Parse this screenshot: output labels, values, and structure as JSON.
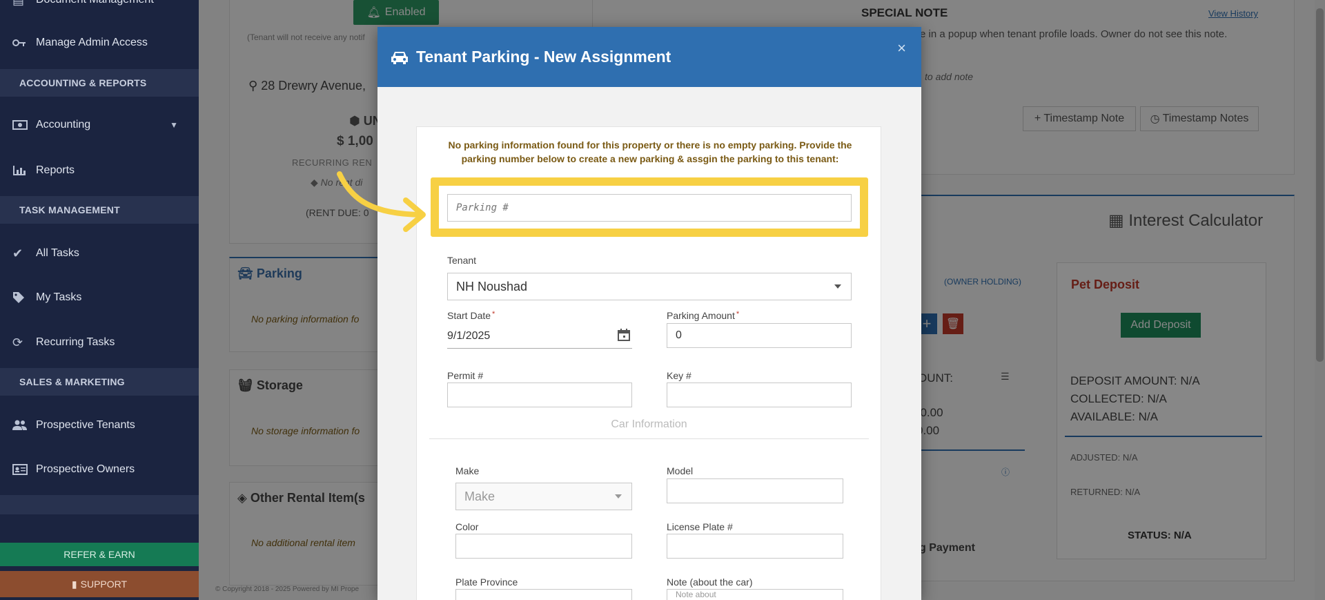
{
  "sidebar": {
    "items_top": [
      {
        "label": "Document Management",
        "icon": "document-icon"
      },
      {
        "label": "Manage Admin Access",
        "icon": "key-icon"
      }
    ],
    "section_accounting": "ACCOUNTING & REPORTS",
    "accounting": "Accounting",
    "reports": "Reports",
    "section_tasks": "TASK MANAGEMENT",
    "all_tasks": "All Tasks",
    "my_tasks": "My Tasks",
    "recurring_tasks": "Recurring Tasks",
    "section_sales": "SALES & MARKETING",
    "prospective_tenants": "Prospective Tenants",
    "prospective_owners": "Prospective Owners",
    "refer": "REFER & EARN",
    "support": "SUPPORT"
  },
  "background": {
    "enabled": "Enabled",
    "tenant_note": "(Tenant will not receive any notif",
    "address": "28 Drewry Avenue,",
    "unit": "UN",
    "amount": "$ 1,00",
    "recurring": "RECURRING REN",
    "no_rent": "No rent di",
    "rent_due": "(RENT DUE: 0",
    "parking_title": "Parking",
    "parking_text": "No parking information fo",
    "storage_title": "Storage",
    "storage_text": "No storage information fo",
    "other_title": "Other Rental Item(s",
    "other_text": "No additional rental item",
    "special_note_title": "SPECIAL NOTE",
    "view_history": "View History",
    "special_note_text": "e in a popup when tenant profile loads. Owner do not see this note.",
    "add_note": "to add note",
    "timestamp_note": "+ Timestamp Note",
    "timestamp_notes": "Timestamp Notes",
    "interest_calc": "Interest Calculator",
    "owner_holding": "(OWNER HOLDING)",
    "amount_label": "OUNT:",
    "amt1": "$0.00",
    "amt2": "0.00",
    "payment": "g Payment",
    "pet_deposit": "Pet Deposit",
    "add_deposit": "Add Deposit",
    "deposit_amount": "DEPOSIT AMOUNT: N/A",
    "collected": "COLLECTED: N/A",
    "available": "AVAILABLE: N/A",
    "adjusted": "ADJUSTED: N/A",
    "returned": "RETURNED: N/A",
    "status": "STATUS: N/A",
    "copyright": "© Copyright 2018 - 2025 Powered by MI Prope"
  },
  "modal": {
    "title": "Tenant Parking - New Assignment",
    "close": "×",
    "notice": "No parking information found for this property or there is no empty parking. Provide the parking number below to create a new parking & assgin the parking to this tenant:",
    "parking_placeholder": "Parking #",
    "tenant_label": "Tenant",
    "tenant_value": "NH Noushad",
    "start_date_label": "Start Date",
    "start_date_value": "9/1/2025",
    "parking_amount_label": "Parking Amount",
    "parking_amount_value": "0",
    "permit_label": "Permit #",
    "key_label": "Key #",
    "car_info": "Car Information",
    "make_label": "Make",
    "make_placeholder": "Make",
    "model_label": "Model",
    "color_label": "Color",
    "license_label": "License Plate #",
    "plate_province_label": "Plate Province",
    "note_label": "Note (about the car)",
    "note_placeholder": "Note about"
  },
  "colors": {
    "sidebar": "#1b2440",
    "header": "#2f6fb0",
    "highlight": "#f7d044"
  }
}
